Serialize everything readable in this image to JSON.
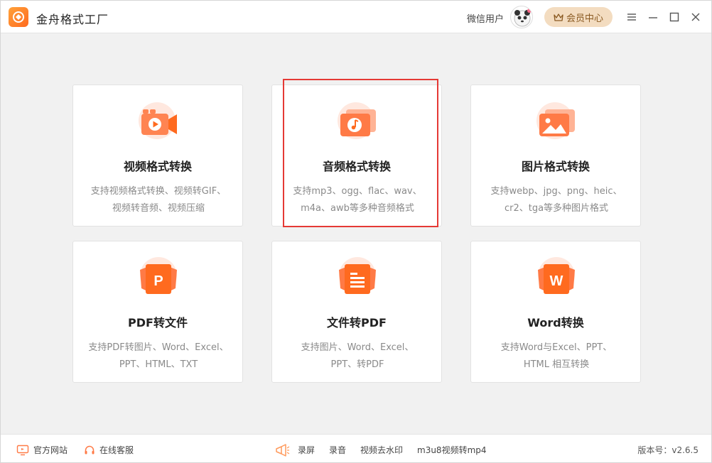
{
  "app": {
    "title": "金舟格式工厂"
  },
  "header": {
    "user_name": "微信用户",
    "vip_label": "会员中心"
  },
  "cards": [
    {
      "title": "视频格式转换",
      "desc_line1": "支持视频格式转换、视频转GIF、",
      "desc_line2": "视频转音频、视频压缩"
    },
    {
      "title": "音频格式转换",
      "desc_line1": "支持mp3、ogg、flac、wav、",
      "desc_line2": "m4a、awb等多种音频格式"
    },
    {
      "title": "图片格式转换",
      "desc_line1": "支持webp、jpg、png、heic、",
      "desc_line2": "cr2、tga等多种图片格式"
    },
    {
      "title": "PDF转文件",
      "desc_line1": "支持PDF转图片、Word、Excel、",
      "desc_line2": "PPT、HTML、TXT"
    },
    {
      "title": "文件转PDF",
      "desc_line1": "支持图片、Word、Excel、",
      "desc_line2": "PPT、转PDF"
    },
    {
      "title": "Word转换",
      "desc_line1": "支持Word与Excel、PPT、",
      "desc_line2": "HTML 相互转换"
    }
  ],
  "icons": {
    "pdf_letter": "P",
    "word_letter": "W"
  },
  "footer": {
    "website": "官方网站",
    "support": "在线客服",
    "screen_record": "录屏",
    "audio_record": "录音",
    "watermark": "视频去水印",
    "m3u8": "m3u8视频转mp4",
    "version": "版本号：v2.6.5"
  },
  "colors": {
    "accent": "#ff6a1f",
    "icon_light": "#ffd3c2",
    "vip_bg": "#f3dcc0",
    "highlight": "#e53935"
  }
}
